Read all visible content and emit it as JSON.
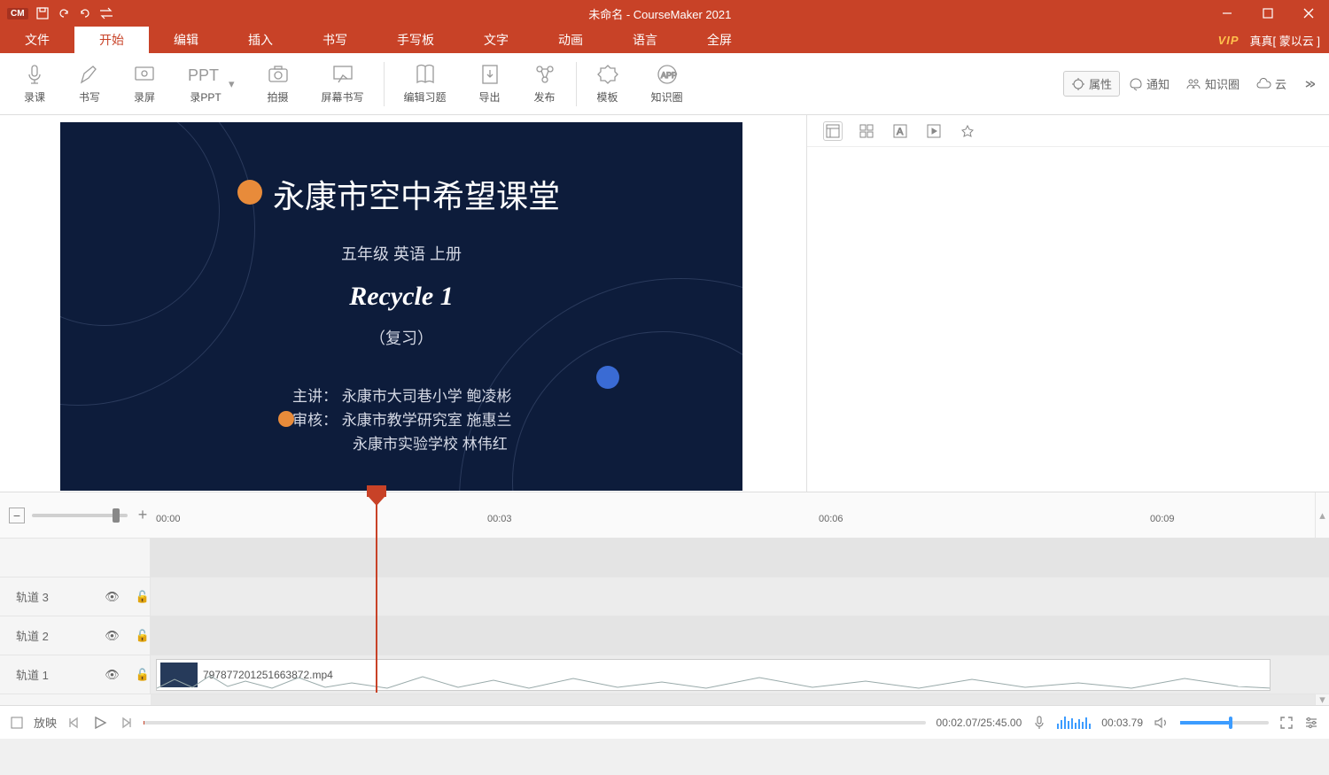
{
  "title": "未命名 - CourseMaker 2021",
  "account": "真真[ 蒙以云 ]",
  "vip": "VIP",
  "menu": {
    "file": "文件",
    "start": "开始",
    "edit": "编辑",
    "insert": "插入",
    "write": "书写",
    "tablet": "手写板",
    "text": "文字",
    "anim": "动画",
    "lang": "语言",
    "fullscreen": "全屏"
  },
  "ribbon": {
    "record": "录课",
    "write": "书写",
    "screen": "录屏",
    "ppt": "录PPT",
    "shoot": "拍摄",
    "screenwrite": "屏幕书写",
    "exercise": "编辑习题",
    "export": "导出",
    "publish": "发布",
    "template": "模板",
    "circle": "知识圈"
  },
  "rpanel": {
    "props": "属性",
    "notify": "通知",
    "circle": "知识圈",
    "cloud": "云"
  },
  "slide": {
    "title": "永康市空中希望课堂",
    "subtitle": "五年级  英语  上册",
    "main": "Recycle 1",
    "note": "（复习）",
    "l1": "主讲：   永康市大司巷小学       鲍凌彬",
    "l2": "审核：   永康市教学研究室       施惠兰",
    "l3": "永康市实验学校       林伟红"
  },
  "ruler": {
    "t0": "00:00",
    "t3": "00:03",
    "t6": "00:06",
    "t9": "00:09"
  },
  "tracks": {
    "t3": "轨道 3",
    "t2": "轨道 2",
    "t1": "轨道 1"
  },
  "clip": {
    "name": "797877201251663872.mp4"
  },
  "playbar": {
    "play": "放映",
    "time": "00:02.07/25:45.00",
    "rec": "00:03.79"
  }
}
